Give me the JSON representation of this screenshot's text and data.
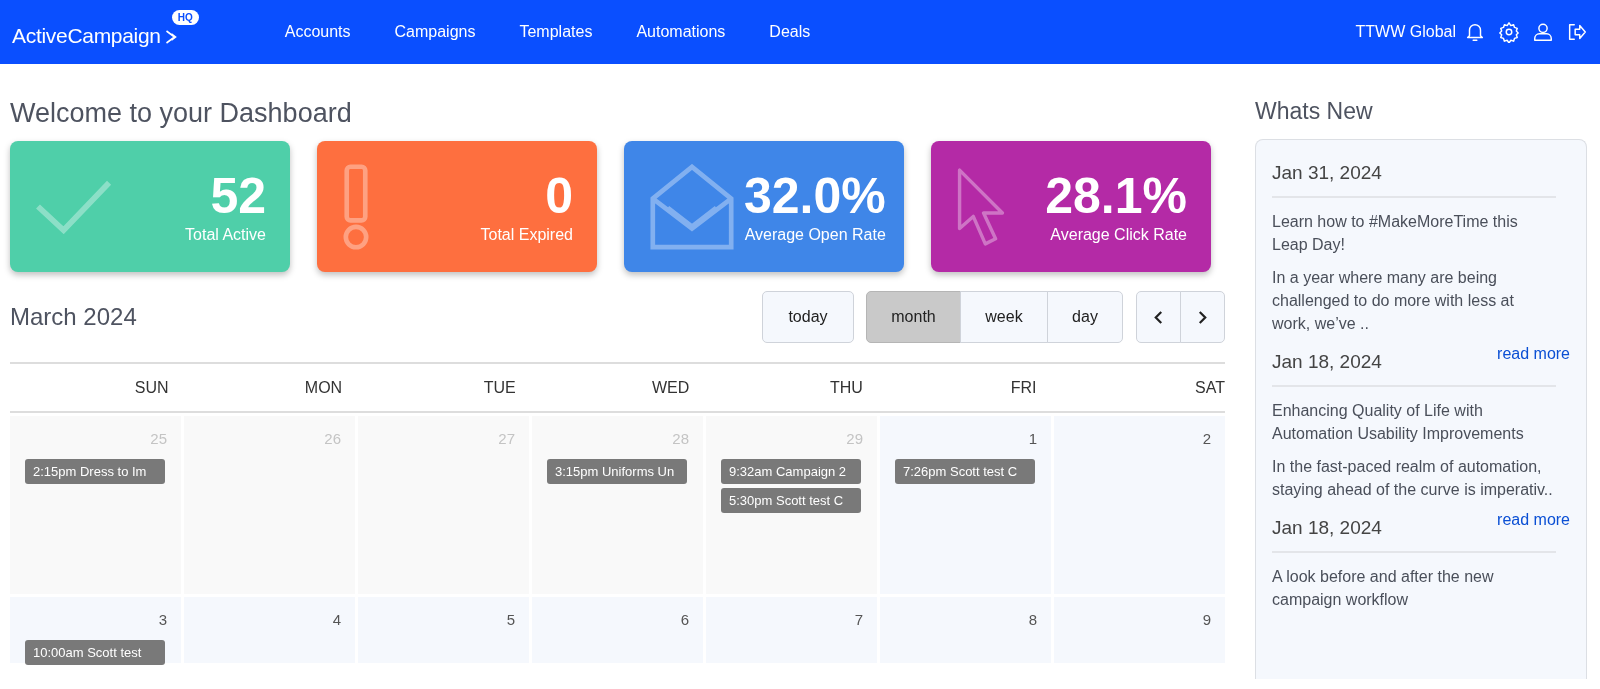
{
  "navbar": {
    "logo": "ActiveCampaign",
    "logo_badge": "HQ",
    "links": [
      "Accounts",
      "Campaigns",
      "Templates",
      "Automations",
      "Deals"
    ],
    "account": "TTWW Global"
  },
  "dashboard": {
    "title": "Welcome to your Dashboard",
    "stats": [
      {
        "kind": "check",
        "value": "52",
        "label": "Total Active",
        "color": "#4fcfa9"
      },
      {
        "kind": "alert",
        "value": "0",
        "label": "Total Expired",
        "color": "#fe6f3f"
      },
      {
        "kind": "mail",
        "value": "32.0%",
        "label": "Average Open Rate",
        "color": "#3f86e8"
      },
      {
        "kind": "cursor",
        "value": "28.1%",
        "label": "Average Click Rate",
        "color": "#b42aa6"
      }
    ]
  },
  "calendar": {
    "title": "March 2024",
    "today_button": "today",
    "views": [
      {
        "label": "month",
        "selected": true
      },
      {
        "label": "week",
        "selected": false
      },
      {
        "label": "day",
        "selected": false
      }
    ],
    "weekdays": [
      "SUN",
      "MON",
      "TUE",
      "WED",
      "THU",
      "FRI",
      "SAT"
    ],
    "weeks": [
      [
        {
          "day": "25",
          "other_month": true,
          "events": [
            "2:15pm Dress to Im"
          ]
        },
        {
          "day": "26",
          "other_month": true
        },
        {
          "day": "27",
          "other_month": true
        },
        {
          "day": "28",
          "other_month": true,
          "events": [
            "3:15pm Uniforms Un"
          ]
        },
        {
          "day": "29",
          "other_month": true,
          "events": [
            "9:32am Campaign 2",
            "5:30pm Scott test C"
          ]
        },
        {
          "day": "1",
          "other_month": false,
          "events": [
            "7:26pm Scott test C"
          ]
        },
        {
          "day": "2",
          "other_month": false
        }
      ],
      [
        {
          "day": "3",
          "other_month": false,
          "events": [
            "10:00am Scott test"
          ]
        },
        {
          "day": "4",
          "other_month": false
        },
        {
          "day": "5",
          "other_month": false
        },
        {
          "day": "6",
          "other_month": false
        },
        {
          "day": "7",
          "other_month": false
        },
        {
          "day": "8",
          "other_month": false
        },
        {
          "day": "9",
          "other_month": false
        }
      ]
    ]
  },
  "whats_new": {
    "title": "Whats New",
    "posts": [
      {
        "date": "Jan 31, 2024",
        "title": "Learn how to #MakeMoreTime this Leap Day!",
        "excerpt": "In a year where many are being challenged to do more with less at work, we’ve ..",
        "link": "read more"
      },
      {
        "date": "Jan 18, 2024",
        "title": "Enhancing Quality of Life with Automation Usability Improvements",
        "excerpt": "In the fast-paced realm of automation, staying ahead of the curve is imperativ..",
        "link": "read more"
      },
      {
        "date": "Jan 18, 2024",
        "title": "A look before and after the new campaign workflow"
      }
    ]
  }
}
